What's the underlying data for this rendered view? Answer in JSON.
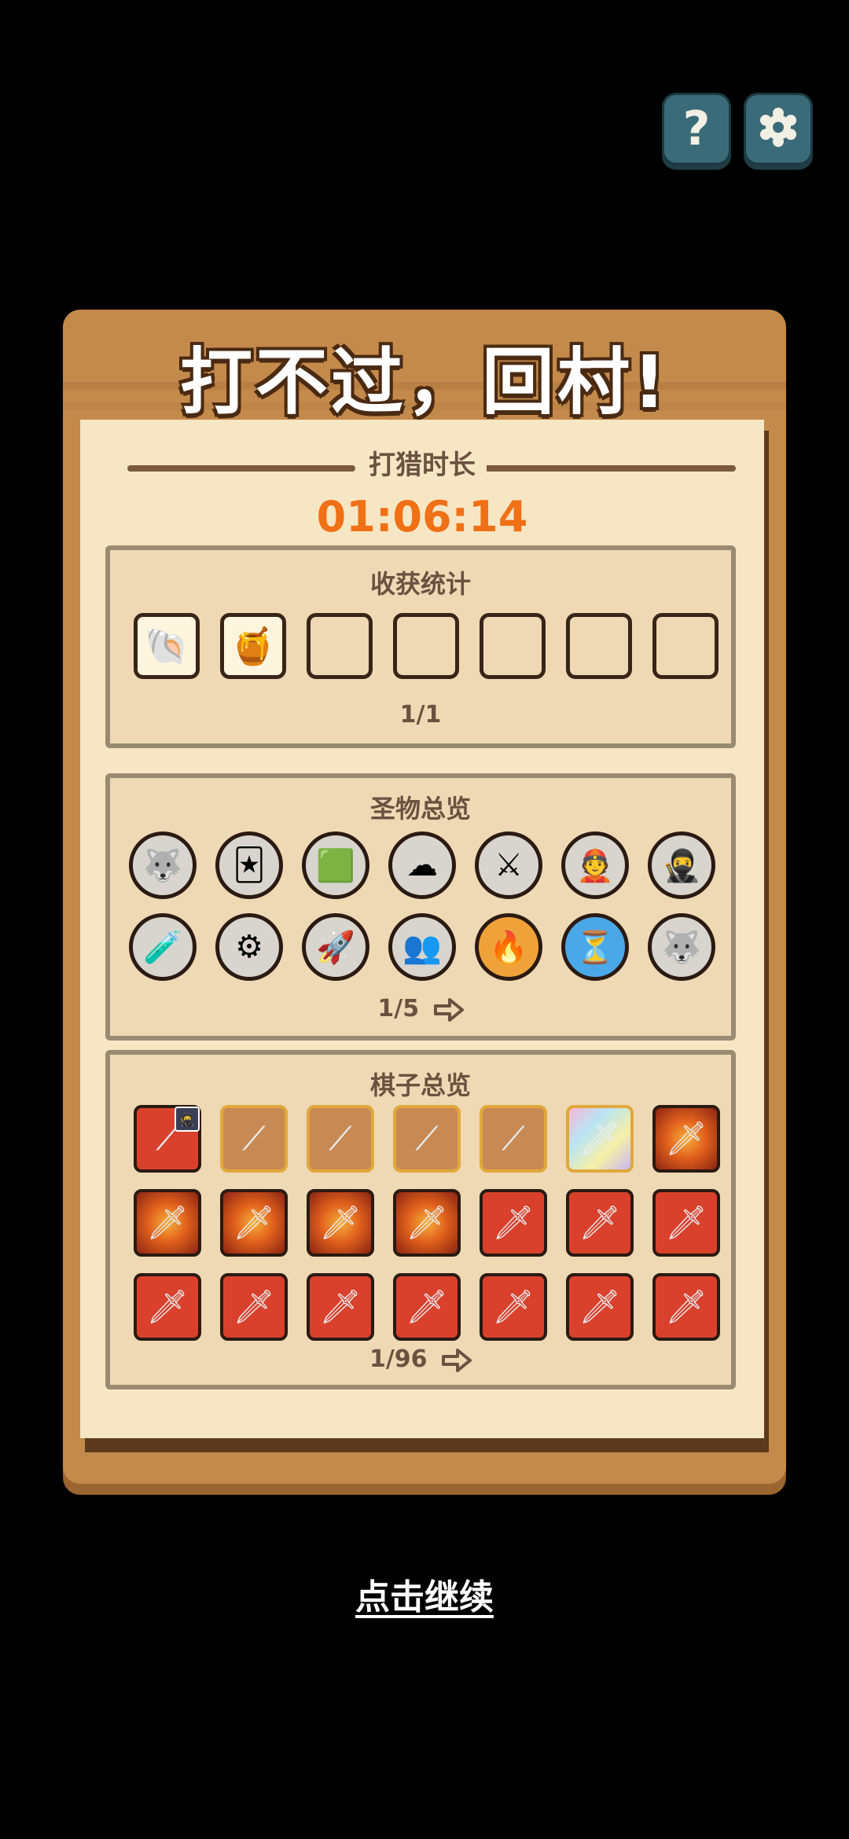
{
  "top_buttons": {
    "help_glyph": "?",
    "settings_icon": "gear-icon"
  },
  "title": "打不过，回村!",
  "hunt": {
    "label": "打猎时长",
    "time": "01:06:14"
  },
  "harvest": {
    "title": "收获统计",
    "slots": [
      {
        "filled": true,
        "icon": "shell-icon"
      },
      {
        "filled": true,
        "icon": "honey-jar-icon"
      },
      {
        "filled": false
      },
      {
        "filled": false
      },
      {
        "filled": false
      },
      {
        "filled": false
      },
      {
        "filled": false
      }
    ],
    "page": "1/1"
  },
  "relics": {
    "title": "圣物总览",
    "items": [
      "wolf-pack-icon",
      "card-sword-icon",
      "green-cubes-icon",
      "golden-cloud-icon",
      "crossed-blades-icon",
      "general-portrait-icon",
      "ninja-mask-icon",
      "red-potion-icon",
      "gear-puzzle-icon",
      "rocket-sword-icon",
      "ninja-duo-icon",
      "fire-orb-icon",
      "hourglass-icon",
      "wolf-head-icon"
    ],
    "page": "1/5"
  },
  "pieces": {
    "title": "棋子总览",
    "items": [
      "red-spear",
      "tan-spear",
      "tan-spear",
      "tan-spear",
      "tan-spear",
      "rainbow-sword",
      "fire-sword",
      "fire-sword",
      "fire-sword",
      "fire-sword",
      "fire-sword",
      "red-sword",
      "red-sword",
      "red-sword",
      "red-sword",
      "red-sword",
      "red-sword",
      "red-sword",
      "red-sword",
      "red-sword",
      "red-sword"
    ],
    "page": "1/96"
  },
  "continue_label": "点击继续",
  "colors": {
    "timer": "#f07016",
    "board": "#c48a4c",
    "paper": "#f7e6c4",
    "panel": "#eed9b4"
  }
}
